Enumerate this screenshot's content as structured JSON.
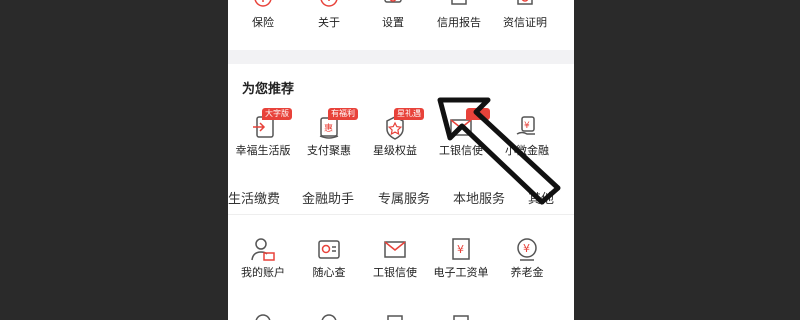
{
  "top_row": [
    {
      "label": "保险",
      "icon": "shield-plus-icon"
    },
    {
      "label": "关于",
      "icon": "info-circle-icon"
    },
    {
      "label": "设置",
      "icon": "gear-icon"
    },
    {
      "label": "信用报告",
      "icon": "report-icon"
    },
    {
      "label": "资信证明",
      "icon": "certificate-icon"
    }
  ],
  "recommend": {
    "title": "为您推荐",
    "items": [
      {
        "label": "幸福生活版",
        "tag": "大字版",
        "icon": "tablet-arrow-icon"
      },
      {
        "label": "支付聚惠",
        "tag": "有福利",
        "icon": "coupon-icon"
      },
      {
        "label": "星级权益",
        "tag": "星礼遇",
        "icon": "star-badge-icon"
      },
      {
        "label": "工银信使",
        "tag": "",
        "icon": "envelope-icon"
      },
      {
        "label": "小微金融",
        "tag": "",
        "icon": "hand-money-icon"
      }
    ]
  },
  "tabs": [
    "生活缴费",
    "金融助手",
    "专属服务",
    "本地服务",
    "其他"
  ],
  "services": [
    {
      "label": "我的账户",
      "icon": "user-card-icon"
    },
    {
      "label": "随心查",
      "icon": "chart-card-icon"
    },
    {
      "label": "工银信使",
      "icon": "envelope-icon"
    },
    {
      "label": "电子工资单",
      "icon": "yen-document-icon"
    },
    {
      "label": "养老金",
      "icon": "yen-globe-icon"
    }
  ],
  "colors": {
    "accent": "#e8423a",
    "icon_line": "#555555",
    "divider": "#f2f2f4"
  }
}
